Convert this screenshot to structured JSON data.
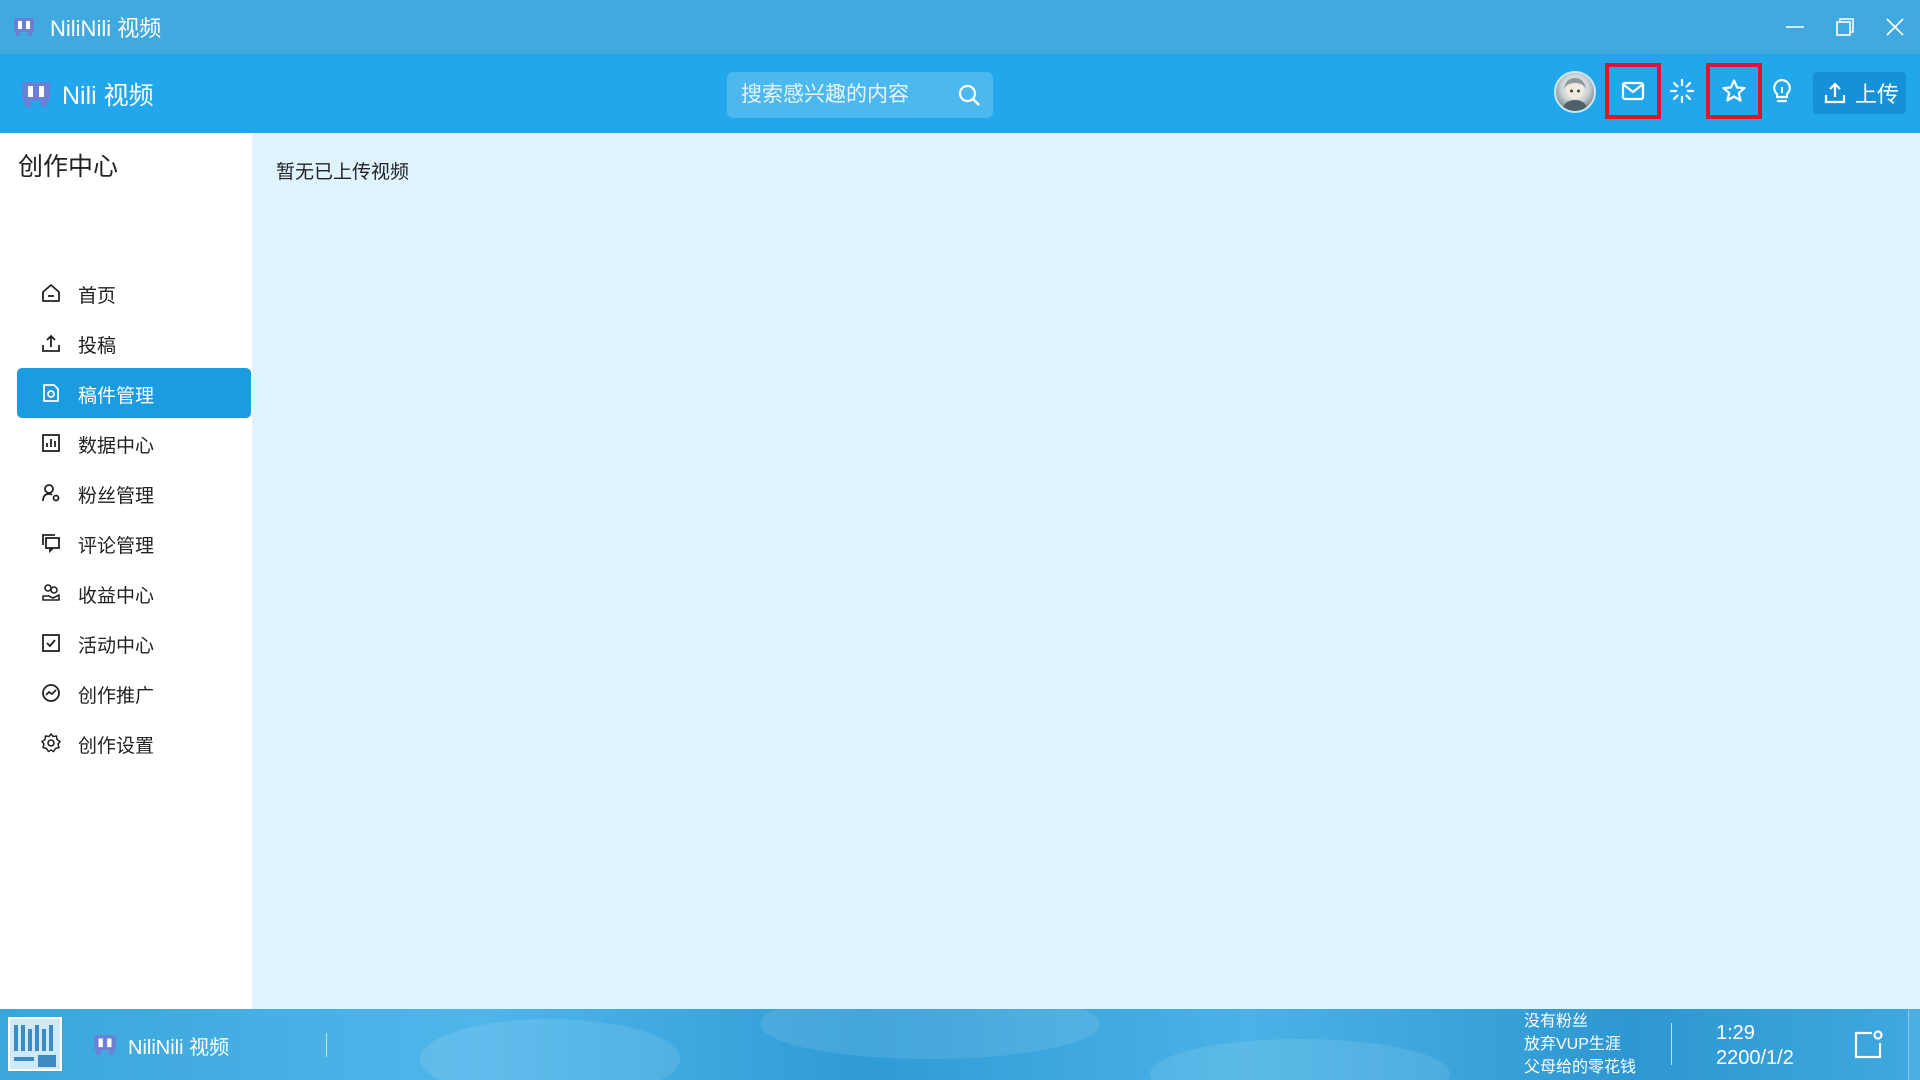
{
  "window": {
    "title": "NiliNili 视频",
    "controls": [
      "minimize-icon",
      "restore-icon",
      "close-icon"
    ]
  },
  "header": {
    "brand": "Nili 视频",
    "search_placeholder": "搜索感兴趣的内容",
    "icons": [
      "avatar",
      "mail-icon",
      "loading-spinner-icon",
      "star-icon",
      "lightbulb-icon"
    ],
    "highlighted_icons": [
      "mail-icon",
      "star-icon"
    ],
    "upload_label": "上传"
  },
  "sidebar": {
    "title": "创作中心",
    "items": [
      {
        "label": "首页",
        "icon": "home-icon"
      },
      {
        "label": "投稿",
        "icon": "upload-icon"
      },
      {
        "label": "稿件管理",
        "icon": "document-icon",
        "active": true
      },
      {
        "label": "数据中心",
        "icon": "bar-chart-icon"
      },
      {
        "label": "粉丝管理",
        "icon": "user-gear-icon"
      },
      {
        "label": "评论管理",
        "icon": "comment-icon"
      },
      {
        "label": "收益中心",
        "icon": "coins-hand-icon"
      },
      {
        "label": "活动中心",
        "icon": "checkbox-icon"
      },
      {
        "label": "创作推广",
        "icon": "trend-icon"
      },
      {
        "label": "创作设置",
        "icon": "gear-icon"
      }
    ]
  },
  "main": {
    "empty_message": "暂无已上传视频"
  },
  "taskbar": {
    "app_label": "NiliNili 视频",
    "tray_lines": [
      "没有粉丝",
      "放弃VUP生涯",
      "父母给的零花钱"
    ],
    "time": "1:29",
    "date": "2200/1/2"
  },
  "colors": {
    "titlebar": "#40a9df",
    "header": "#22a6ec",
    "accent": "#1b9be0",
    "content_bg": "#dff3fd",
    "highlight_border": "#e0142a"
  }
}
